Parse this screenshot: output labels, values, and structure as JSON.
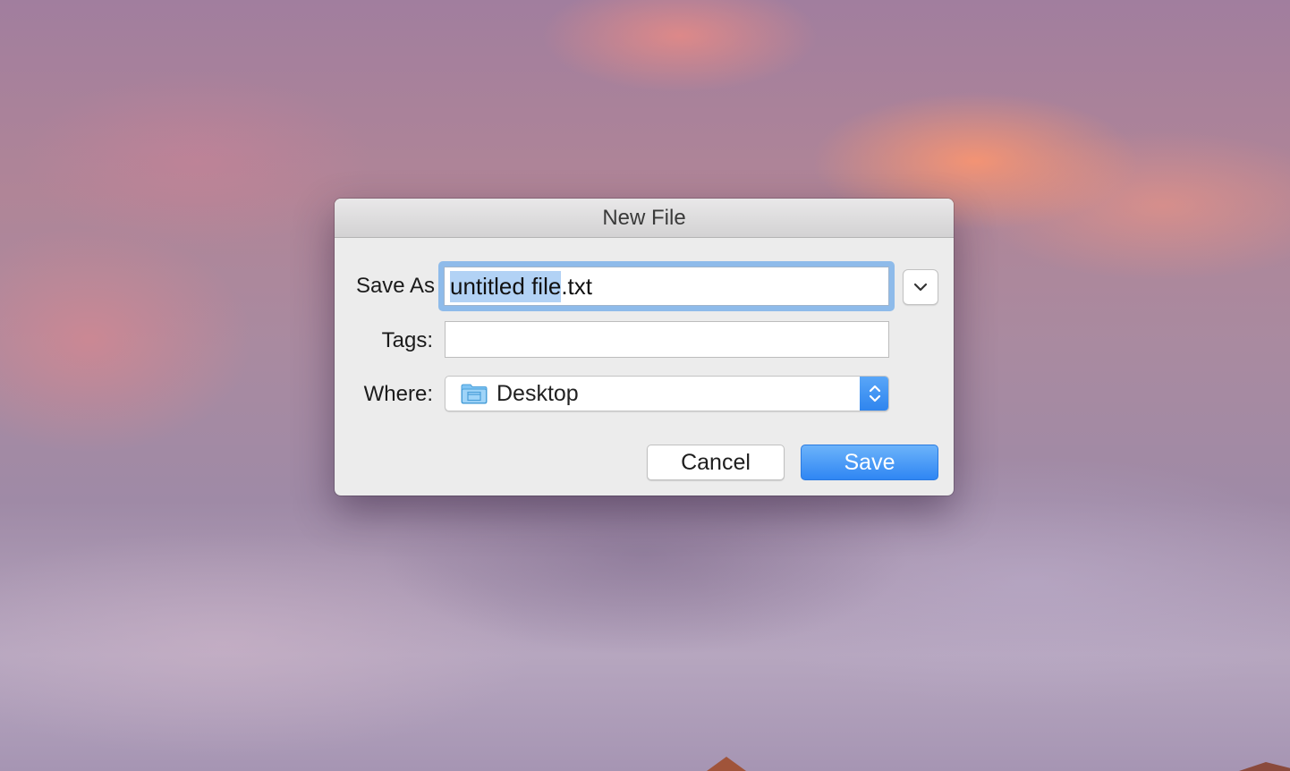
{
  "dialog": {
    "title": "New File",
    "save_as_label": "Save As",
    "filename_selected": "untitled file",
    "filename_extension": ".txt",
    "tags_label": "Tags:",
    "tags_value": "",
    "where_label": "Where:",
    "location": "Desktop",
    "cancel_label": "Cancel",
    "save_label": "Save"
  },
  "colors": {
    "accent": "#2f86f3",
    "selection": "#b2d2f5",
    "focus_ring": "#8ebbea"
  },
  "icons": {
    "expand": "chevron-down-icon",
    "folder": "folder-icon",
    "stepper": "up-down-chevron-icon"
  }
}
